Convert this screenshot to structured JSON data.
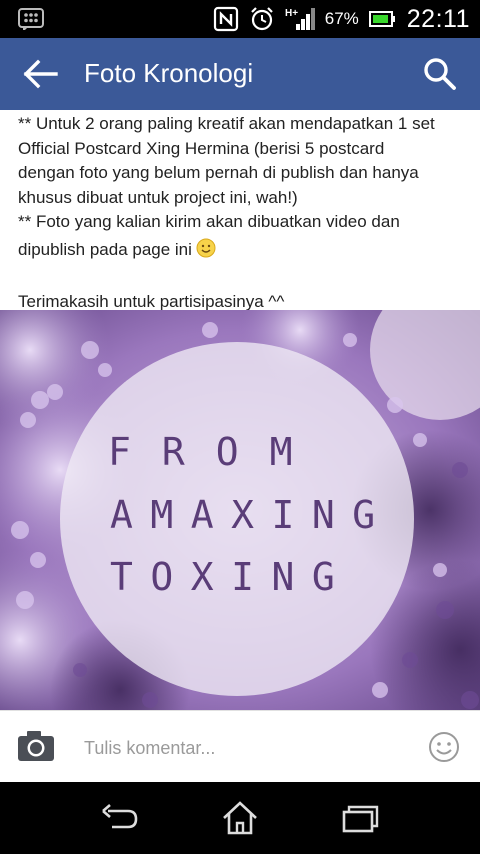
{
  "status_bar": {
    "left_icon": "bbm-icon",
    "icons": [
      "nfc-icon",
      "alarm-clock-icon",
      "hplus-signal-icon",
      "battery-icon"
    ],
    "network_label": "H+",
    "battery_percent": "67%",
    "time": "22:11"
  },
  "app_bar": {
    "title": "Foto Kronologi",
    "back_icon": "arrow-left-icon",
    "search_icon": "search-icon",
    "color": "#3b5998"
  },
  "post": {
    "lines": [
      "** Untuk 2 orang paling kreatif akan mendapatkan 1 set",
      "Official Postcard Xing Hermina (berisi 5 postcard",
      "dengan foto yang belum pernah di publish dan hanya",
      "khusus dibuat untuk project ini, wah!)",
      "** Foto yang kalian kirim akan dibuatkan video dan",
      "dipublish pada page ini"
    ],
    "thanks": "Terimakasih untuk partisipasinya ^^",
    "emoji": "smile-emoji-icon"
  },
  "image": {
    "line1": "FROM",
    "line2": "AMAXING",
    "line3": "TOXING",
    "text_color": "#5a3d78"
  },
  "comment_bar": {
    "camera_icon": "camera-icon",
    "placeholder": "Tulis komentar...",
    "smiley_icon": "smiley-icon"
  },
  "nav_bar": {
    "back_icon": "back-icon",
    "home_icon": "home-icon",
    "recent_icon": "recent-apps-icon"
  }
}
